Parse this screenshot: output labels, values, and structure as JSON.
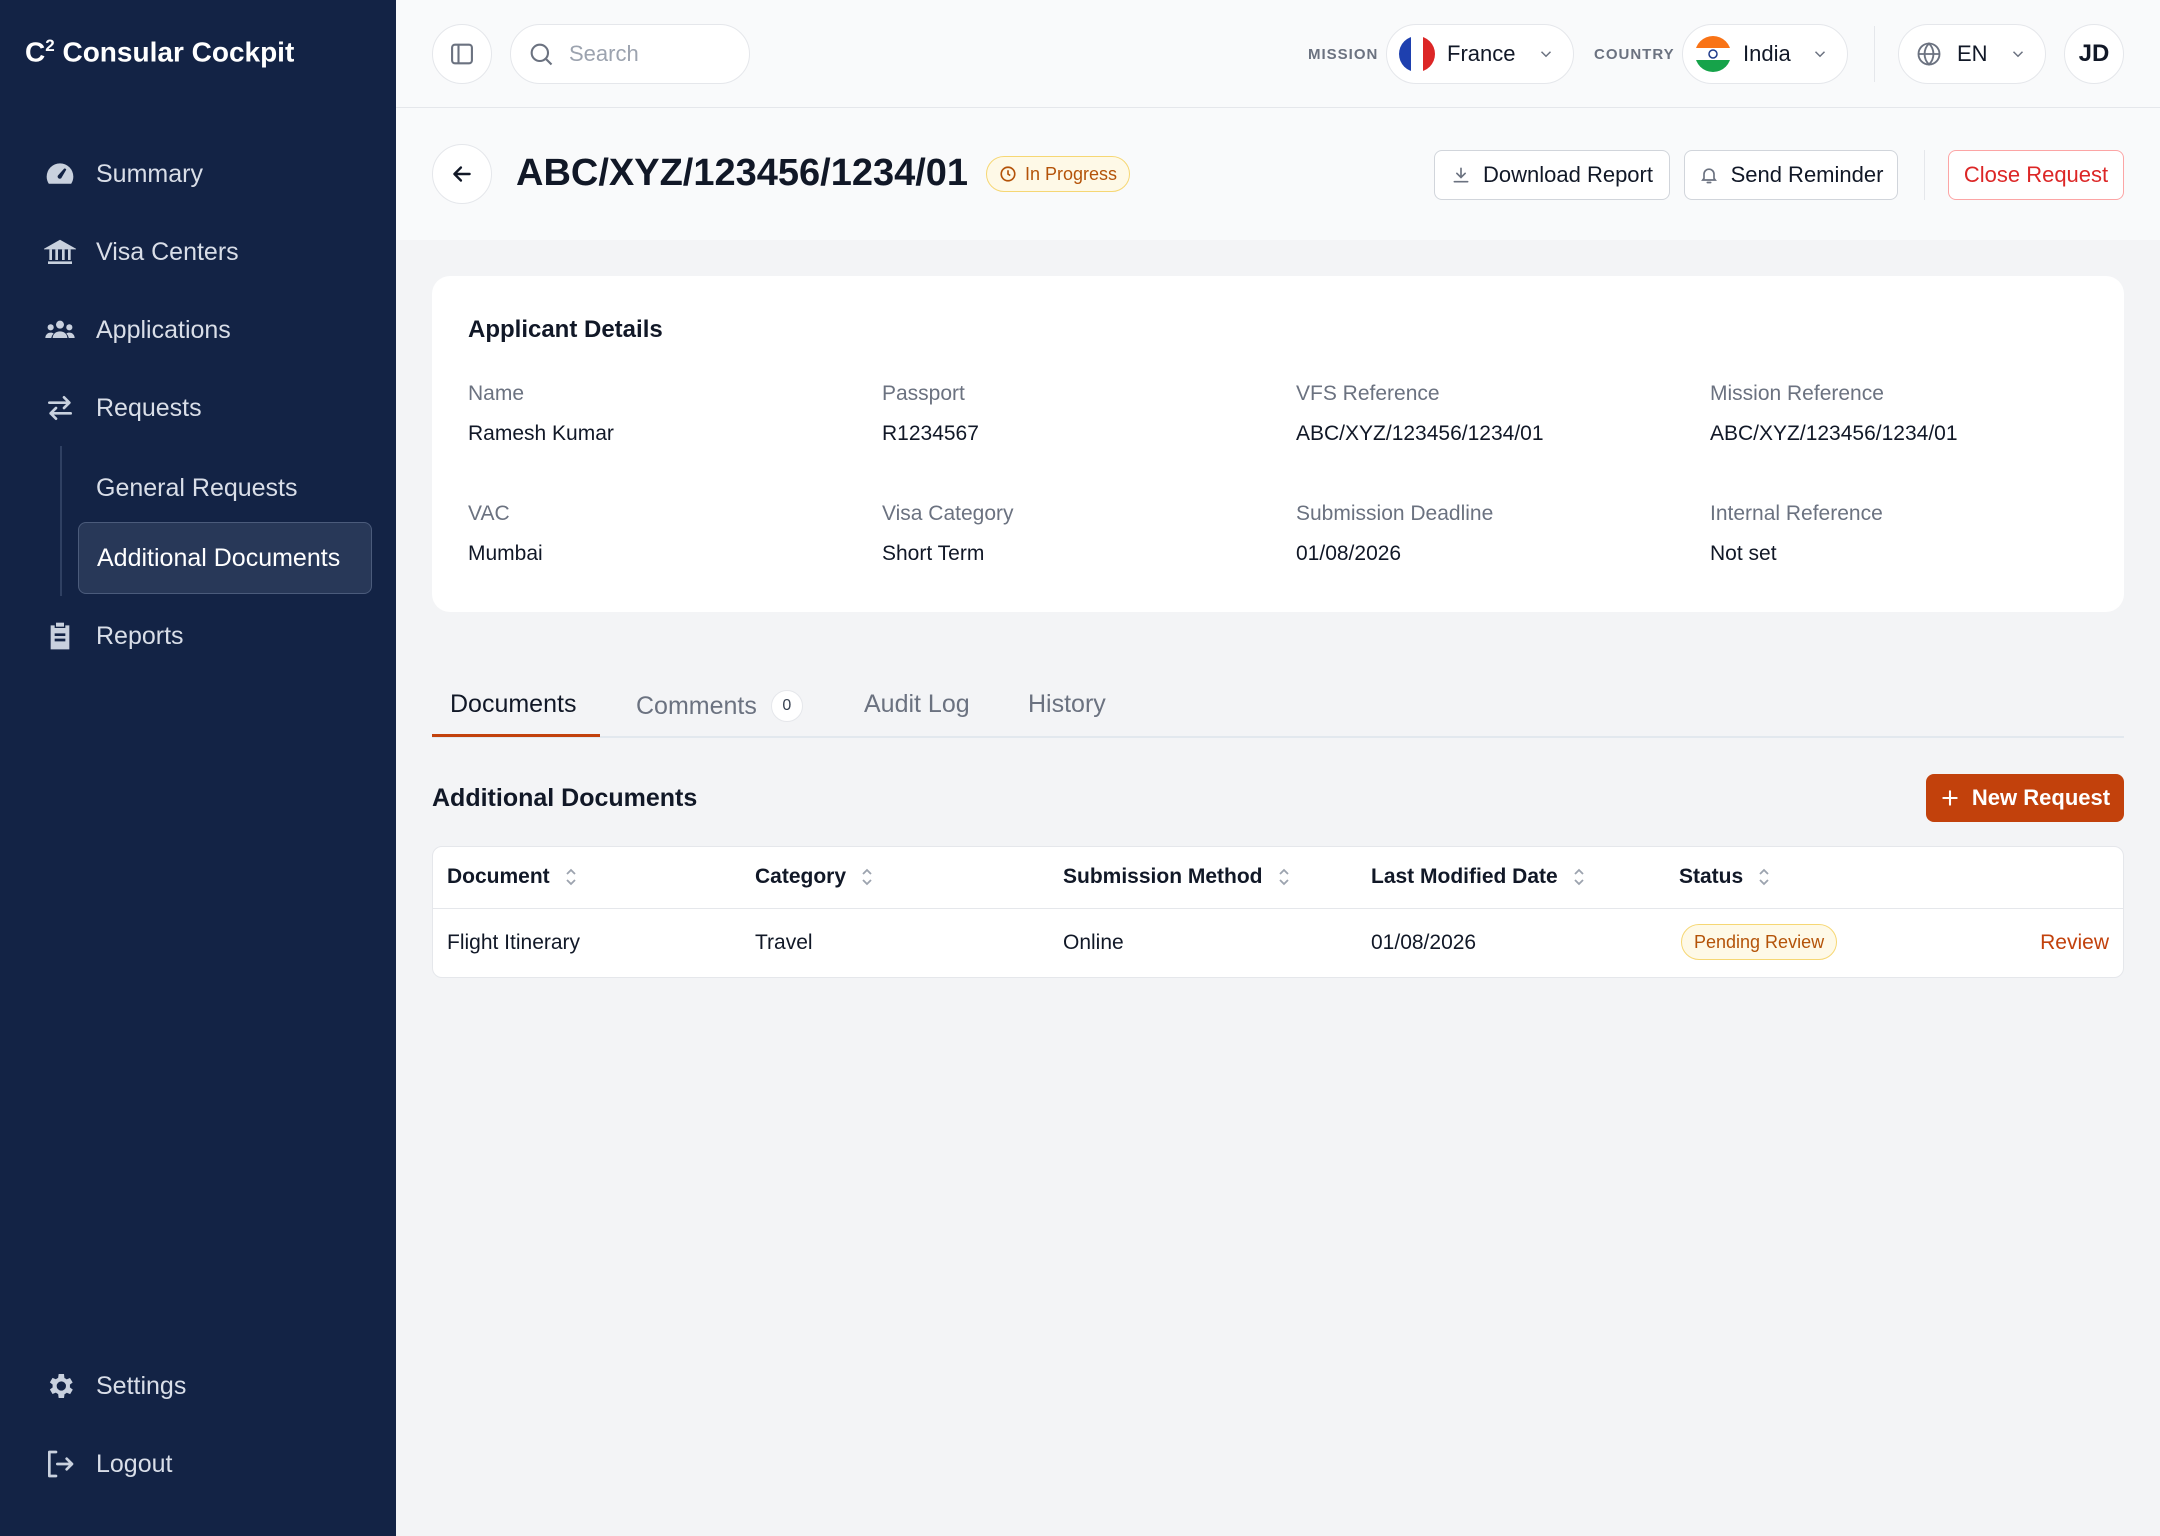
{
  "app": {
    "brand_prefix": "C",
    "brand_sup": "2",
    "brand_name": " Consular Cockpit"
  },
  "sidebar": {
    "items": [
      {
        "label": "Summary",
        "icon": "gauge-icon"
      },
      {
        "label": "Visa Centers",
        "icon": "bank-icon"
      },
      {
        "label": "Applications",
        "icon": "users-icon"
      },
      {
        "label": "Requests",
        "icon": "arrows-exchange-icon"
      },
      {
        "label": "Reports",
        "icon": "clipboard-icon"
      }
    ],
    "sub_items": [
      {
        "label": "General Requests"
      },
      {
        "label": "Additional Documents"
      }
    ],
    "bottom": [
      {
        "label": "Settings",
        "icon": "gear-icon"
      },
      {
        "label": "Logout",
        "icon": "logout-icon"
      }
    ]
  },
  "topbar": {
    "search_placeholder": "Search",
    "mission_label": "MISSION",
    "mission_value": "France",
    "country_label": "COUNTRY",
    "country_value": "India",
    "language": "EN",
    "avatar_initials": "JD"
  },
  "header": {
    "title": "ABC/XYZ/123456/1234/01",
    "status": "In Progress",
    "download_label": "Download Report",
    "reminder_label": "Send Reminder",
    "close_label": "Close Request"
  },
  "applicant": {
    "title": "Applicant Details",
    "fields": [
      {
        "label": "Name",
        "value": "Ramesh Kumar"
      },
      {
        "label": "Passport",
        "value": "R1234567"
      },
      {
        "label": "VFS Reference",
        "value": "ABC/XYZ/123456/1234/01"
      },
      {
        "label": "Mission Reference",
        "value": "ABC/XYZ/123456/1234/01"
      },
      {
        "label": "VAC",
        "value": "Mumbai"
      },
      {
        "label": "Visa Category",
        "value": "Short Term"
      },
      {
        "label": "Submission Deadline",
        "value": "01/08/2026"
      },
      {
        "label": "Internal Reference",
        "value": "Not set"
      }
    ]
  },
  "tabs": [
    {
      "label": "Documents"
    },
    {
      "label": "Comments",
      "count": "0"
    },
    {
      "label": "Audit Log"
    },
    {
      "label": "History"
    }
  ],
  "documents": {
    "title": "Additional Documents",
    "new_label": "New Request",
    "columns": [
      "Document",
      "Category",
      "Submission Method",
      "Last Modified Date",
      "Status"
    ],
    "rows": [
      {
        "document": "Flight Itinerary",
        "category": "Travel",
        "method": "Online",
        "date": "01/08/2026",
        "status": "Pending Review",
        "action": "Review"
      }
    ]
  },
  "colors": {
    "sidebar_bg": "#132345",
    "accent": "#c2410c",
    "danger": "#dc2626",
    "warning": "#b45309"
  }
}
